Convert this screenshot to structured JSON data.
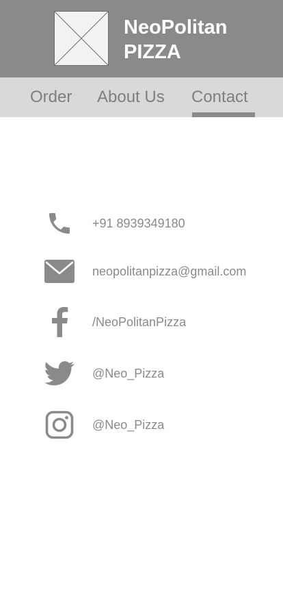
{
  "header": {
    "logo_icon": "image-placeholder-icon",
    "brand_line1": "NeoPolitan",
    "brand_line2": "PIZZA",
    "background_color": "#8a8a8a"
  },
  "nav": {
    "items": [
      {
        "label": "Order"
      },
      {
        "label": "About Us"
      },
      {
        "label": "Contact"
      }
    ],
    "active": "Contact",
    "background_color": "#d9d9d9"
  },
  "contacts": [
    {
      "icon": "phone-icon",
      "text": "+91 8939349180"
    },
    {
      "icon": "mail-icon",
      "text": "neopolitanpizza@gmail.com"
    },
    {
      "icon": "facebook-icon",
      "text": "/NeoPolitanPizza"
    },
    {
      "icon": "twitter-icon",
      "text": "@Neo_Pizza"
    },
    {
      "icon": "instagram-icon",
      "text": "@Neo_Pizza"
    }
  ],
  "colors": {
    "icon": "#8a8a8a",
    "text": "#8a8a8a"
  }
}
